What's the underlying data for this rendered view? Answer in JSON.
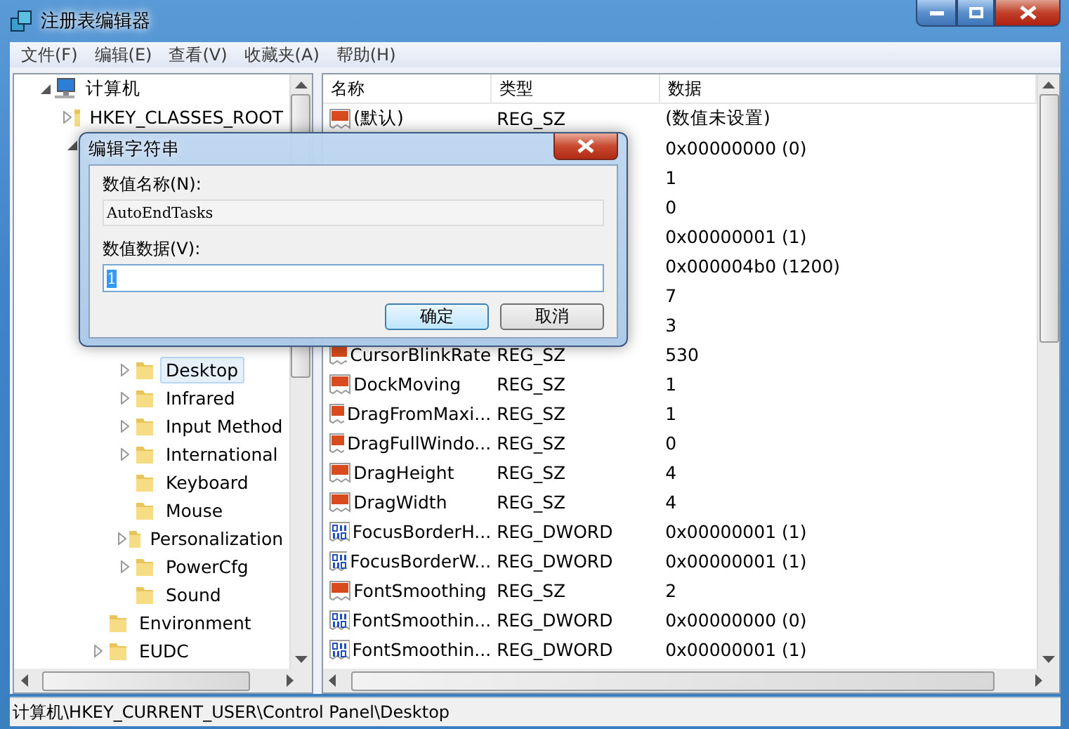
{
  "window": {
    "title": "注册表编辑器"
  },
  "menu": [
    "文件(F)",
    "编辑(E)",
    "查看(V)",
    "收藏夹(A)",
    "帮助(H)"
  ],
  "tree": [
    {
      "label": "计算机",
      "kind": "computer",
      "expanded": true,
      "selected": false,
      "children": [
        {
          "label": "HKEY_CLASSES_ROOT",
          "expanded": false,
          "selected": false
        },
        {
          "expanded": true,
          "children": [
            {
              "children": [
                {
                  "label": "Desktop",
                  "expanded": false,
                  "selected": true
                },
                {
                  "label": "Infrared",
                  "expanded": false,
                  "selected": false
                },
                {
                  "label": "Input Method",
                  "expanded": false,
                  "selected": false
                },
                {
                  "label": "International",
                  "expanded": false,
                  "selected": false
                },
                {
                  "label": "Keyboard",
                  "selected": false
                },
                {
                  "label": "Mouse",
                  "selected": false
                },
                {
                  "label": "Personalization",
                  "expanded": false,
                  "selected": false
                },
                {
                  "label": "PowerCfg",
                  "expanded": false,
                  "selected": false
                },
                {
                  "label": "Sound",
                  "selected": false
                }
              ]
            },
            {
              "label": "Environment",
              "selected": false
            },
            {
              "label": "EUDC",
              "expanded": false,
              "selected": false
            }
          ]
        }
      ]
    }
  ],
  "table": {
    "columns": [
      "名称",
      "类型",
      "数据"
    ],
    "rows": [
      {
        "kind": "sz",
        "name": "(默认)",
        "type": "REG_SZ",
        "data": "(数值未设置)"
      },
      {
        "data": "0x00000000 (0)"
      },
      {
        "data": "1"
      },
      {
        "data": "0"
      },
      {
        "data": "0x00000001 (1)"
      },
      {
        "data": "0x000004b0 (1200)"
      },
      {
        "data": "7"
      },
      {
        "data": "3"
      },
      {
        "kind": "sz",
        "name": "CursorBlinkRate",
        "type": "REG_SZ",
        "data": "530"
      },
      {
        "kind": "sz",
        "name": "DockMoving",
        "type": "REG_SZ",
        "data": "1"
      },
      {
        "kind": "sz",
        "name": "DragFromMaxi...",
        "type": "REG_SZ",
        "data": "1"
      },
      {
        "kind": "sz",
        "name": "DragFullWindo...",
        "type": "REG_SZ",
        "data": "0"
      },
      {
        "kind": "sz",
        "name": "DragHeight",
        "type": "REG_SZ",
        "data": "4"
      },
      {
        "kind": "sz",
        "name": "DragWidth",
        "type": "REG_SZ",
        "data": "4"
      },
      {
        "kind": "dword",
        "name": "FocusBorderH...",
        "type": "REG_DWORD",
        "data": "0x00000001 (1)"
      },
      {
        "kind": "dword",
        "name": "FocusBorderW...",
        "type": "REG_DWORD",
        "data": "0x00000001 (1)"
      },
      {
        "kind": "sz",
        "name": "FontSmoothing",
        "type": "REG_SZ",
        "data": "2"
      },
      {
        "kind": "dword",
        "name": "FontSmoothin...",
        "type": "REG_DWORD",
        "data": "0x00000000 (0)"
      },
      {
        "kind": "dword",
        "name": "FontSmoothin...",
        "type": "REG_DWORD",
        "data": "0x00000001 (1)"
      }
    ]
  },
  "status_bar": "计算机\\HKEY_CURRENT_USER\\Control Panel\\Desktop",
  "dialog": {
    "title": "编辑字符串",
    "name_label": "数值名称(N):",
    "name_value": "AutoEndTasks",
    "data_label": "数值数据(V):",
    "data_value": "1",
    "buttons": [
      {
        "label": "确定",
        "default": true
      },
      {
        "label": "取消",
        "default": false
      }
    ]
  }
}
